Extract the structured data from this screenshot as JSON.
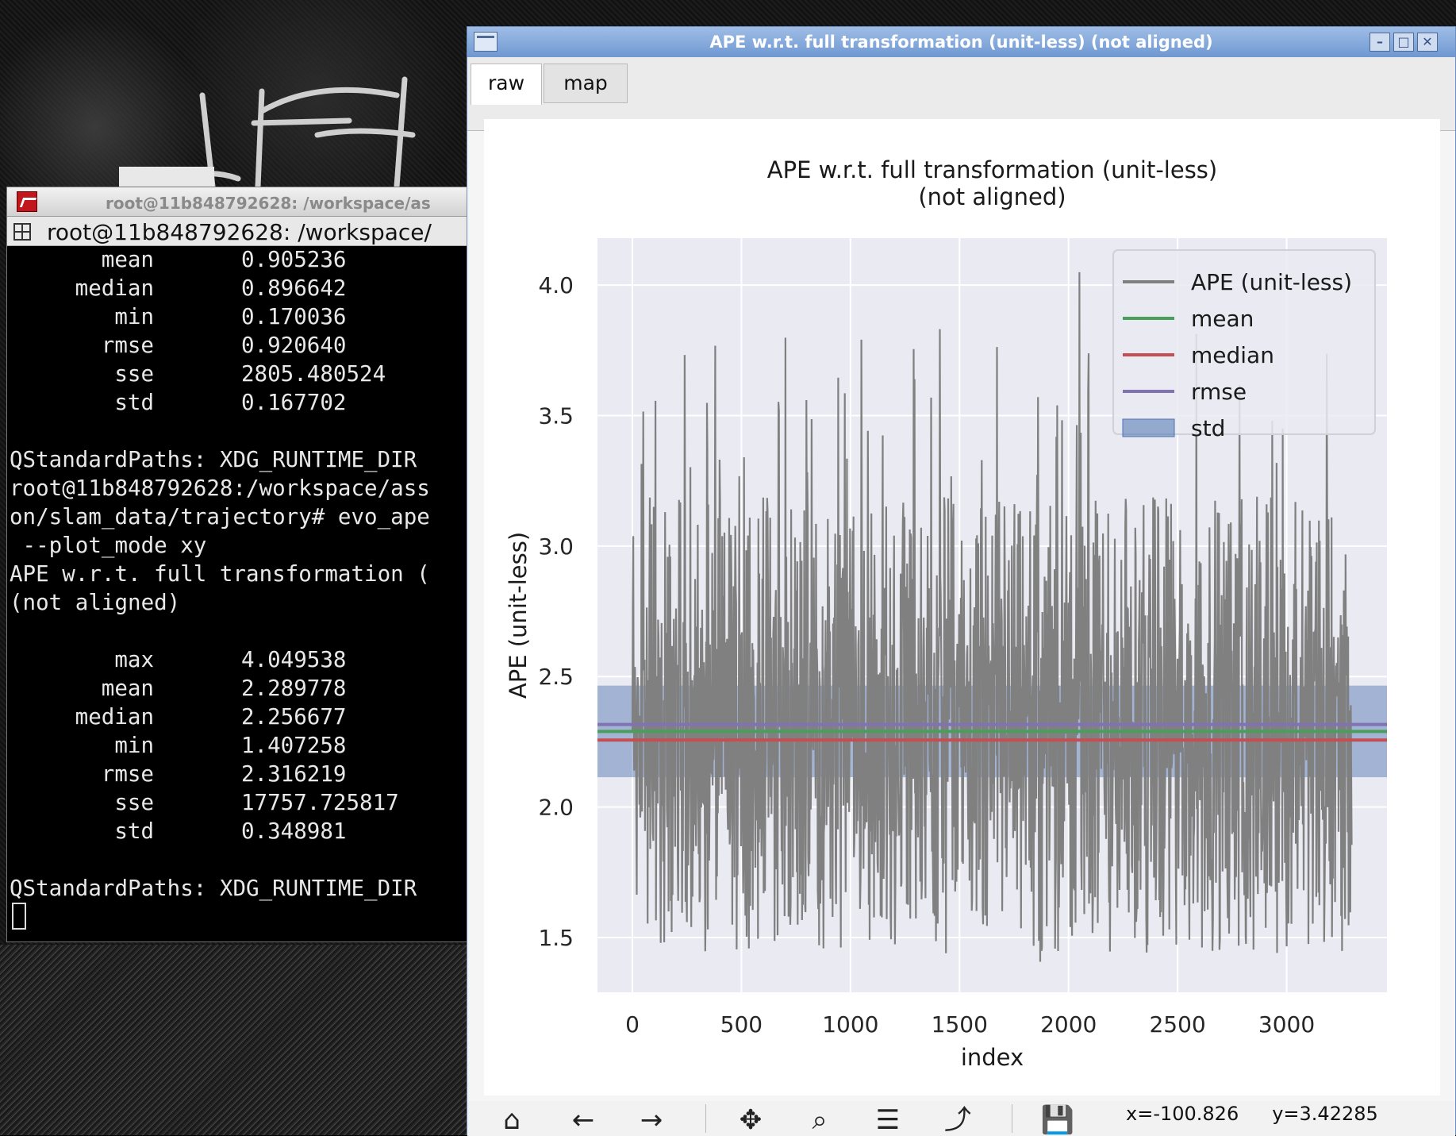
{
  "terminal": {
    "window_title": "root@11b848792628: /workspace/as",
    "tab_title": "root@11b848792628: /workspace/",
    "stats_top": [
      {
        "key": "mean",
        "value": "0.905236"
      },
      {
        "key": "median",
        "value": "0.896642"
      },
      {
        "key": "min",
        "value": "0.170036"
      },
      {
        "key": "rmse",
        "value": "0.920640"
      },
      {
        "key": "sse",
        "value": "2805.480524"
      },
      {
        "key": "std",
        "value": "0.167702"
      }
    ],
    "lines": [
      "QStandardPaths: XDG_RUNTIME_DIR",
      "root@11b848792628:/workspace/ass",
      "on/slam_data/trajectory# evo_ape",
      " --plot_mode xy",
      "APE w.r.t. full transformation (",
      "(not aligned)"
    ],
    "stats_bottom": [
      {
        "key": "max",
        "value": "4.049538"
      },
      {
        "key": "mean",
        "value": "2.289778"
      },
      {
        "key": "median",
        "value": "2.256677"
      },
      {
        "key": "min",
        "value": "1.407258"
      },
      {
        "key": "rmse",
        "value": "2.316219"
      },
      {
        "key": "sse",
        "value": "17757.725817"
      },
      {
        "key": "std",
        "value": "0.348981"
      }
    ],
    "last_line": "QStandardPaths: XDG_RUNTIME_DIR"
  },
  "plot_window": {
    "title": "APE w.r.t. full transformation (unit-less) (not aligned)",
    "tabs": [
      {
        "label": "raw",
        "active": true
      },
      {
        "label": "map",
        "active": false
      }
    ],
    "toolbar": {
      "icons": [
        "home-icon",
        "back-icon",
        "forward-icon",
        "pan-icon",
        "zoom-icon",
        "configure-subplots-icon",
        "edit-axis-icon",
        "save-icon"
      ],
      "coord_x": "x=-100.826",
      "coord_y": "y=3.42285"
    }
  },
  "chart_data": {
    "type": "line",
    "title": [
      "APE w.r.t. full transformation (unit-less)",
      "(not aligned)"
    ],
    "xlabel": "index",
    "ylabel": "APE (unit-less)",
    "xlim": [
      -160,
      3460
    ],
    "ylim": [
      1.29,
      4.18
    ],
    "xticks": [
      0,
      500,
      1000,
      1500,
      2000,
      2500,
      3000
    ],
    "yticks": [
      1.5,
      2.0,
      2.5,
      3.0,
      3.5,
      4.0
    ],
    "grid": true,
    "legend_position": "top-right",
    "n_points": 3300,
    "series": [
      {
        "name": "APE (unit-less)",
        "color": "#808080",
        "kind": "signal",
        "max": 4.049538,
        "min": 1.407258,
        "max_index": 2050,
        "min_index": 1870
      },
      {
        "name": "mean",
        "color": "#4a9e5c",
        "kind": "hline",
        "value": 2.289778
      },
      {
        "name": "median",
        "color": "#c44e52",
        "kind": "hline",
        "value": 2.256677
      },
      {
        "name": "rmse",
        "color": "#8172b2",
        "kind": "hline",
        "value": 2.316219
      },
      {
        "name": "std",
        "color": "#4c72b0",
        "kind": "band",
        "lower": 2.114287,
        "upper": 2.465269
      }
    ],
    "background": "#eaeaf2"
  }
}
